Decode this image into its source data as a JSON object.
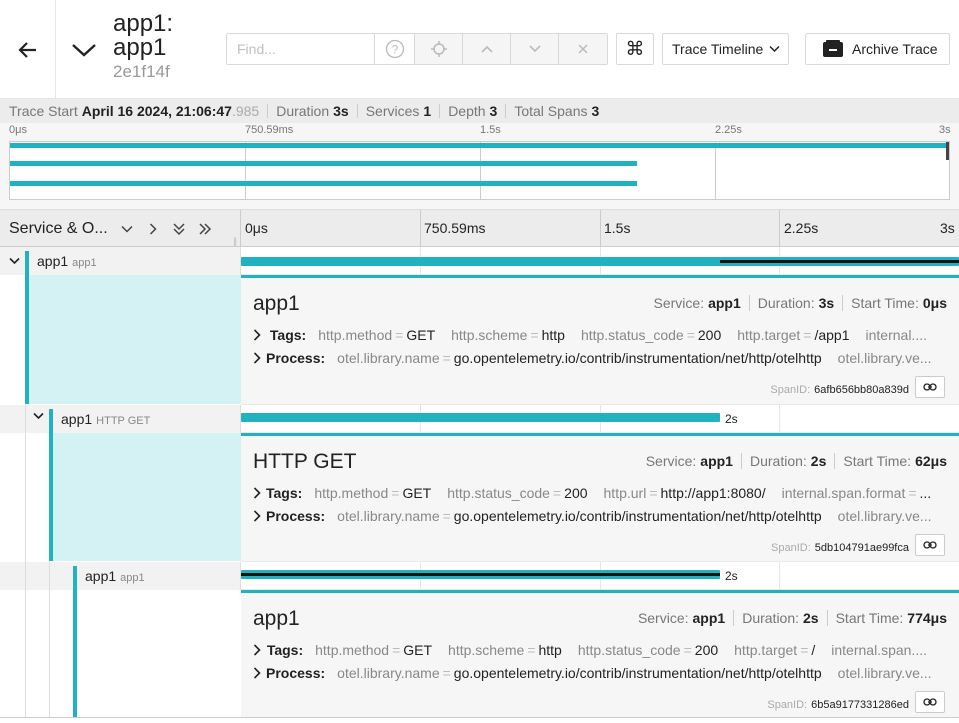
{
  "header": {
    "title": "app1: app1",
    "trace_id": "2e1f14f",
    "search": {
      "placeholder": "Find..."
    },
    "view_select": "Trace Timeline",
    "archive_label": "Archive Trace",
    "kbd_glyph": "⌘"
  },
  "summary": {
    "trace_start_label": "Trace Start",
    "trace_start_value": "April 16 2024, 21:06:47",
    "trace_start_ms": ".985",
    "duration_label": "Duration",
    "duration_value": "3s",
    "services_label": "Services",
    "services_value": "1",
    "depth_label": "Depth",
    "depth_value": "3",
    "total_spans_label": "Total Spans",
    "total_spans_value": "3"
  },
  "minimap": {
    "ticks": [
      "0μs",
      "750.59ms",
      "1.5s",
      "2.25s",
      "3s"
    ]
  },
  "timeline": {
    "column_title": "Service & O...",
    "ticks": [
      "0μs",
      "750.59ms",
      "1.5s",
      "2.25s",
      "3s"
    ]
  },
  "spans": [
    {
      "service": "app1",
      "operation": "app1",
      "title": "app1",
      "service_label": "Service:",
      "service_value": "app1",
      "duration_label": "Duration:",
      "duration_value": "3s",
      "start_label": "Start Time:",
      "start_value": "0μs",
      "bar_label": "",
      "tags": [
        {
          "k": "http.method",
          "v": "GET"
        },
        {
          "k": "http.scheme",
          "v": "http"
        },
        {
          "k": "http.status_code",
          "v": "200"
        },
        {
          "k": "http.target",
          "v": "/app1"
        },
        {
          "k": "internal....",
          "v": ""
        }
      ],
      "process": [
        {
          "k": "otel.library.name",
          "v": "go.opentelemetry.io/contrib/instrumentation/net/http/otelhttp"
        },
        {
          "k": "otel.library.ve...",
          "v": ""
        }
      ],
      "span_id_label": "SpanID:",
      "span_id": "6afb656bb80a839d"
    },
    {
      "service": "app1",
      "operation": "HTTP GET",
      "title": "HTTP GET",
      "service_label": "Service:",
      "service_value": "app1",
      "duration_label": "Duration:",
      "duration_value": "2s",
      "start_label": "Start Time:",
      "start_value": "62μs",
      "bar_label": "2s",
      "tags": [
        {
          "k": "http.method",
          "v": "GET"
        },
        {
          "k": "http.status_code",
          "v": "200"
        },
        {
          "k": "http.url",
          "v": "http://app1:8080/"
        },
        {
          "k": "internal.span.format",
          "v": "..."
        }
      ],
      "process": [
        {
          "k": "otel.library.name",
          "v": "go.opentelemetry.io/contrib/instrumentation/net/http/otelhttp"
        },
        {
          "k": "otel.library.ve...",
          "v": ""
        }
      ],
      "span_id_label": "SpanID:",
      "span_id": "5db104791ae99fca"
    },
    {
      "service": "app1",
      "operation": "app1",
      "title": "app1",
      "service_label": "Service:",
      "service_value": "app1",
      "duration_label": "Duration:",
      "duration_value": "2s",
      "start_label": "Start Time:",
      "start_value": "774μs",
      "bar_label": "2s",
      "tags": [
        {
          "k": "http.method",
          "v": "GET"
        },
        {
          "k": "http.scheme",
          "v": "http"
        },
        {
          "k": "http.status_code",
          "v": "200"
        },
        {
          "k": "http.target",
          "v": "/"
        },
        {
          "k": "internal.span....",
          "v": ""
        }
      ],
      "process": [
        {
          "k": "otel.library.name",
          "v": "go.opentelemetry.io/contrib/instrumentation/net/http/otelhttp"
        },
        {
          "k": "otel.library.ve...",
          "v": ""
        }
      ],
      "span_id_label": "SpanID:",
      "span_id": "6b5a9177331286ed"
    }
  ],
  "labels": {
    "tags": "Tags:",
    "process": "Process:"
  },
  "colors": {
    "accent": "#21b2c0",
    "detail_fill": "#d4f1f4",
    "critical_path": "#111111"
  }
}
